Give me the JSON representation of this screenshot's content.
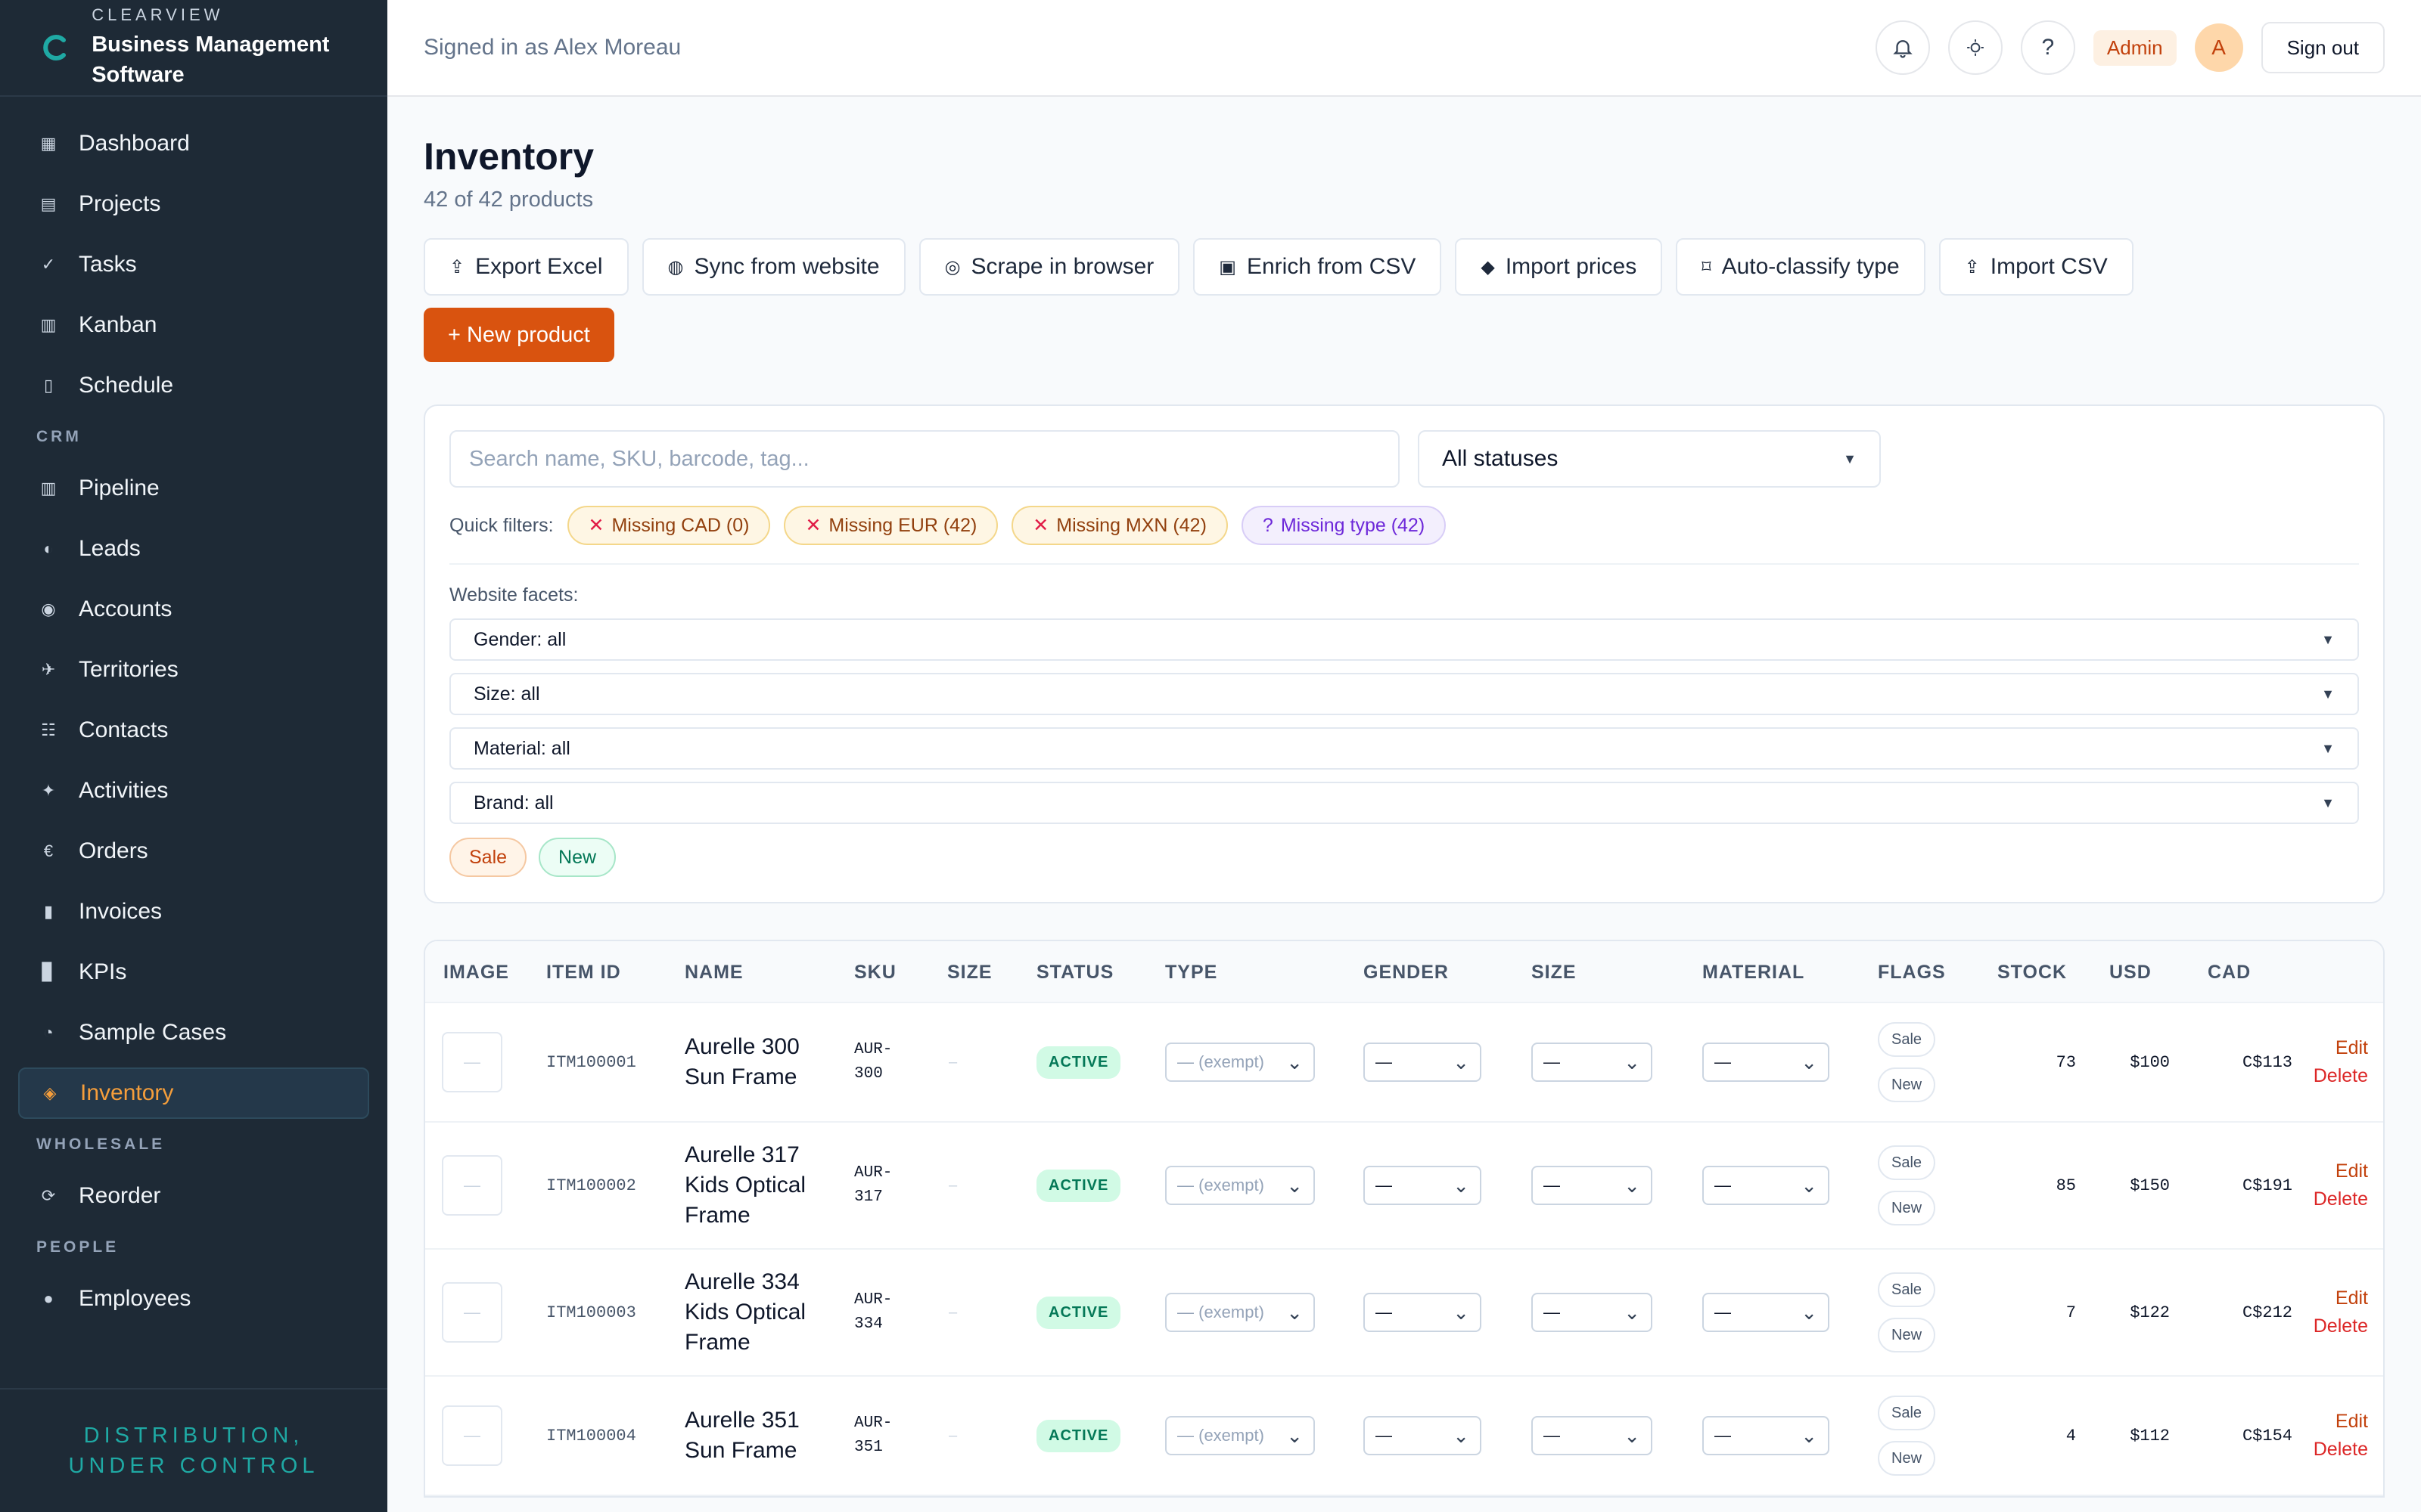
{
  "brand": {
    "kicker": "CLEARVIEW",
    "name": "Business Management Software",
    "tagline": "DISTRIBUTION, UNDER CONTROL"
  },
  "nav": {
    "main": [
      {
        "label": "Dashboard",
        "icon": "grid-icon",
        "glyph": "▦"
      },
      {
        "label": "Projects",
        "icon": "folder-icon",
        "glyph": "▤"
      },
      {
        "label": "Tasks",
        "icon": "check-icon",
        "glyph": "✓"
      },
      {
        "label": "Kanban",
        "icon": "kanban-icon",
        "glyph": "▥"
      },
      {
        "label": "Schedule",
        "icon": "calendar-icon",
        "glyph": "▯"
      }
    ],
    "crm_label": "CRM",
    "crm": [
      {
        "label": "Pipeline",
        "icon": "pipeline-icon",
        "glyph": "▥"
      },
      {
        "label": "Leads",
        "icon": "leads-icon",
        "glyph": "◐"
      },
      {
        "label": "Accounts",
        "icon": "accounts-icon",
        "glyph": "◉"
      },
      {
        "label": "Territories",
        "icon": "map-icon",
        "glyph": "✈"
      },
      {
        "label": "Contacts",
        "icon": "contacts-icon",
        "glyph": "☷"
      },
      {
        "label": "Activities",
        "icon": "sparkle-icon",
        "glyph": "✦"
      },
      {
        "label": "Orders",
        "icon": "euro-icon",
        "glyph": "€"
      },
      {
        "label": "Invoices",
        "icon": "invoice-icon",
        "glyph": "▮"
      },
      {
        "label": "KPIs",
        "icon": "chart-icon",
        "glyph": "▊"
      },
      {
        "label": "Sample Cases",
        "icon": "glasses-icon",
        "glyph": "◔"
      },
      {
        "label": "Inventory",
        "icon": "box-icon",
        "glyph": "◈",
        "active": true
      }
    ],
    "wholesale_label": "WHOLESALE",
    "wholesale": [
      {
        "label": "Reorder",
        "icon": "reorder-icon",
        "glyph": "⟳"
      }
    ],
    "people_label": "PEOPLE",
    "people": [
      {
        "label": "Employees",
        "icon": "people-icon",
        "glyph": "●"
      }
    ]
  },
  "topbar": {
    "signed_in": "Signed in as Alex Moreau",
    "role": "Admin",
    "avatar_initial": "A",
    "sign_out": "Sign out"
  },
  "page": {
    "title": "Inventory",
    "subtitle": "42 of 42 products"
  },
  "toolbar": [
    {
      "label": "Export Excel",
      "icon": "export-icon",
      "glyph": "⇪"
    },
    {
      "label": "Sync from website",
      "icon": "globe-icon",
      "glyph": "◍"
    },
    {
      "label": "Scrape in browser",
      "icon": "compass-icon",
      "glyph": "◎"
    },
    {
      "label": "Enrich from CSV",
      "icon": "image-icon",
      "glyph": "▣"
    },
    {
      "label": "Import prices",
      "icon": "money-bag-icon",
      "glyph": "◆"
    },
    {
      "label": "Auto-classify type",
      "icon": "tag-icon",
      "glyph": "⌑"
    },
    {
      "label": "Import CSV",
      "icon": "import-icon",
      "glyph": "⇪"
    }
  ],
  "new_product": "+ New product",
  "filters": {
    "search_placeholder": "Search name, SKU, barcode, tag...",
    "status": "All statuses",
    "quick_label": "Quick filters:",
    "quick": [
      {
        "label": "Missing CAD (0)",
        "glyph": "✕",
        "variant": "amber"
      },
      {
        "label": "Missing EUR (42)",
        "glyph": "✕",
        "variant": "amber"
      },
      {
        "label": "Missing MXN (42)",
        "glyph": "✕",
        "variant": "amber"
      },
      {
        "label": "Missing type (42)",
        "glyph": "?",
        "variant": "purple"
      }
    ],
    "facets_label": "Website facets:",
    "facets": [
      "Gender: all",
      "Size: all",
      "Material: all",
      "Brand: all"
    ],
    "pills": [
      "Sale",
      "New"
    ]
  },
  "table": {
    "headers": [
      "IMAGE",
      "ITEM ID",
      "NAME",
      "SKU",
      "SIZE",
      "STATUS",
      "TYPE",
      "GENDER",
      "SIZE",
      "MATERIAL",
      "FLAGS",
      "STOCK",
      "USD",
      "CAD"
    ],
    "rows": [
      {
        "id": "ITM100001",
        "name": "Aurelle 300 Sun Frame",
        "sku": "AUR-300",
        "size": "–",
        "status": "ACTIVE",
        "type": "— (exempt)",
        "gender": "—",
        "size_sel": "—",
        "material": "—",
        "flags": [
          "Sale",
          "New"
        ],
        "stock": "73",
        "usd": "$100",
        "cad": "C$113",
        "edit": "Edit",
        "delete": "Delete"
      },
      {
        "id": "ITM100002",
        "name": "Aurelle 317 Kids Optical Frame",
        "sku": "AUR-317",
        "size": "–",
        "status": "ACTIVE",
        "type": "— (exempt)",
        "gender": "—",
        "size_sel": "—",
        "material": "—",
        "flags": [
          "Sale",
          "New"
        ],
        "stock": "85",
        "usd": "$150",
        "cad": "C$191",
        "edit": "Edit",
        "delete": "Delete"
      },
      {
        "id": "ITM100003",
        "name": "Aurelle 334 Kids Optical Frame",
        "sku": "AUR-334",
        "size": "–",
        "status": "ACTIVE",
        "type": "— (exempt)",
        "gender": "—",
        "size_sel": "—",
        "material": "—",
        "flags": [
          "Sale",
          "New"
        ],
        "stock": "7",
        "usd": "$122",
        "cad": "C$212",
        "edit": "Edit",
        "delete": "Delete"
      },
      {
        "id": "ITM100004",
        "name": "Aurelle 351 Sun Frame",
        "sku": "AUR-351",
        "size": "–",
        "status": "ACTIVE",
        "type": "— (exempt)",
        "gender": "—",
        "size_sel": "—",
        "material": "—",
        "flags": [
          "Sale",
          "New"
        ],
        "stock": "4",
        "usd": "$112",
        "cad": "C$154",
        "edit": "Edit",
        "delete": "Delete"
      }
    ]
  }
}
